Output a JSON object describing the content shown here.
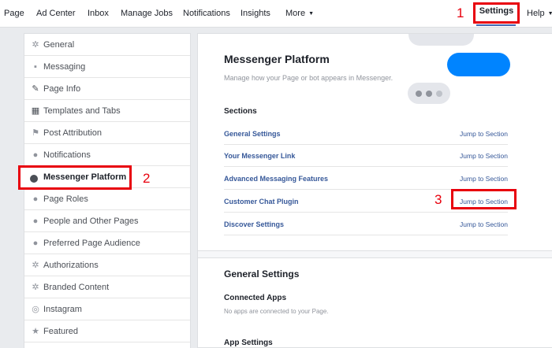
{
  "topnav": {
    "items": [
      "Page",
      "Ad Center",
      "Inbox",
      "Manage Jobs",
      "Notifications",
      "Insights"
    ],
    "more": "More",
    "settings": "Settings",
    "help": "Help"
  },
  "annotations": [
    "1",
    "2",
    "3"
  ],
  "sidebar": {
    "items": [
      {
        "label": "General",
        "icon": "gear-icon"
      },
      {
        "label": "Messaging",
        "icon": "speech-bubble-icon"
      },
      {
        "label": "Page Info",
        "icon": "pencil-icon"
      },
      {
        "label": "Templates and Tabs",
        "icon": "grid-icon"
      },
      {
        "label": "Post Attribution",
        "icon": "flag-icon"
      },
      {
        "label": "Notifications",
        "icon": "globe-icon"
      },
      {
        "label": "Messenger Platform",
        "icon": "messenger-icon",
        "active": true
      },
      {
        "label": "Page Roles",
        "icon": "person-icon"
      },
      {
        "label": "People and Other Pages",
        "icon": "person-plus-icon"
      },
      {
        "label": "Preferred Page Audience",
        "icon": "person-plus-icon"
      },
      {
        "label": "Authorizations",
        "icon": "settings-icon"
      },
      {
        "label": "Branded Content",
        "icon": "settings-icon"
      },
      {
        "label": "Instagram",
        "icon": "instagram-icon"
      },
      {
        "label": "Featured",
        "icon": "star-icon"
      }
    ]
  },
  "main": {
    "title": "Messenger Platform",
    "subtitle": "Manage how your Page or bot appears in Messenger.",
    "sections_heading": "Sections",
    "jump_label": "Jump to Section",
    "sections": [
      "General Settings",
      "Your Messenger Link",
      "Advanced Messaging Features",
      "Customer Chat Plugin",
      "Discover Settings"
    ],
    "general_heading": "General Settings",
    "connected_apps_heading": "Connected Apps",
    "connected_apps_text": "No apps are connected to your Page.",
    "app_settings_heading": "App Settings"
  },
  "colors": {
    "accent": "#4267b2",
    "link": "#365899",
    "annotation": "#e8000d",
    "messenger_blue": "#0084ff"
  }
}
